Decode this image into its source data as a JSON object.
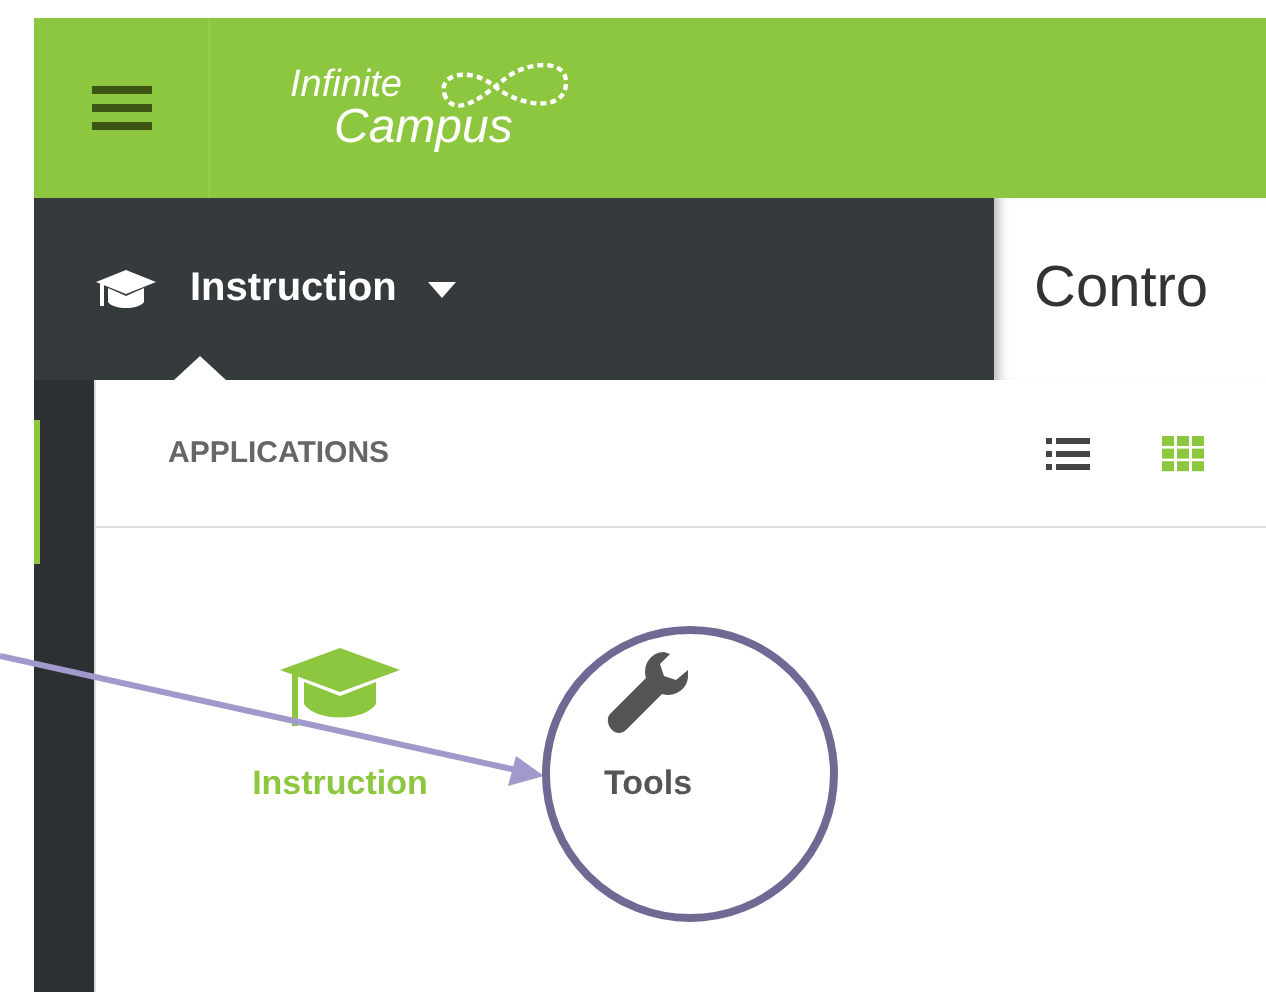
{
  "header": {
    "logo": [
      "Infinite",
      "Campus"
    ]
  },
  "app_switcher": {
    "label": "Instruction"
  },
  "page_title": "Contro",
  "applications_panel": {
    "title": "APPLICATIONS",
    "views": [
      {
        "kind": "list",
        "selected": false
      },
      {
        "kind": "grid",
        "selected": true
      }
    ],
    "apps": [
      {
        "label": "Instruction",
        "kind": "cap",
        "selected": true
      },
      {
        "label": "Tools",
        "kind": "wrench",
        "selected": false
      }
    ]
  }
}
